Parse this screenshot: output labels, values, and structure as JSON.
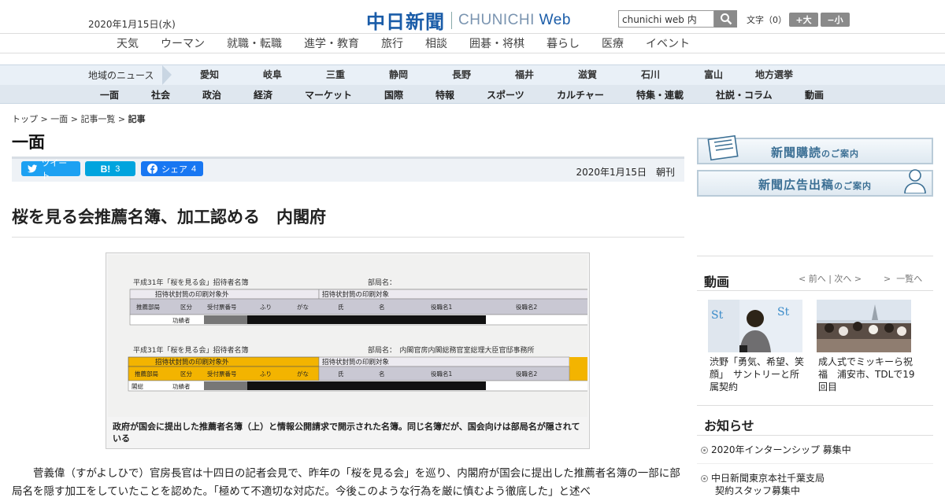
{
  "header": {
    "date": "2020年1月15日(水)",
    "logo_jp": "中日新聞",
    "logo_en_a": "CHUNICHI",
    "logo_en_b": " Web",
    "search_value": "chunichi web 内",
    "font_label": "文字（0）",
    "font_plus": "+大",
    "font_minus": "−小"
  },
  "topnav": [
    "天気",
    "ウーマン",
    "就職・転職",
    "進学・教育",
    "旅行",
    "相談",
    "囲碁・将棋",
    "暮らし",
    "医療",
    "イベント"
  ],
  "regional": {
    "label": "地域のニュース",
    "items": [
      "愛知",
      "岐阜",
      "三重",
      "静岡",
      "長野",
      "福井",
      "滋賀",
      "石川",
      "富山",
      "地方選挙"
    ]
  },
  "sections": [
    "一面",
    "社会",
    "政治",
    "経済",
    "マーケット",
    "国際",
    "特報",
    "スポーツ",
    "カルチャー",
    "特集・連載",
    "社説・コラム",
    "動画"
  ],
  "breadcrumb": {
    "a": "トップ",
    "b": "一面",
    "c": "記事一覧",
    "d": "記事"
  },
  "section_title": "一面",
  "share": {
    "tweet": "ツイート",
    "hatena_label": "B!",
    "hatena_count": "3",
    "fb_label": "シェア",
    "fb_count": "4"
  },
  "article": {
    "date": "2020年1月15日",
    "edition": "朝刊",
    "headline": "桜を見る会推薦名簿、加工認める　内閣府",
    "caption": "政府が国会に提出した推薦者名簿（上）と情報公開請求で開示された名簿。同じ名簿だが、国会向けは部局名が隠されている",
    "doc_top": {
      "title": "平成31年「桜を見る会」招待者名簿",
      "dept_label": "部局名：",
      "not_print": "招待状封筒の印刷対象外",
      "print": "招待状封筒の印刷対象",
      "cols": [
        "推薦部局",
        "区分",
        "受付票番号",
        "ふり",
        "がな",
        "氏",
        "名",
        "役職名1",
        "役職名2"
      ],
      "row_kubun": "功績者"
    },
    "doc_bottom": {
      "title": "平成31年「桜を見る会」招待者名簿",
      "dept_label": "部局名：　内閣官房内閣総務官室総理大臣官邸事務所",
      "not_print": "招待状封筒の印刷対象外",
      "print": "招待状封筒の印刷対象",
      "cols": [
        "推薦部局",
        "区分",
        "受付票番号",
        "ふり",
        "がな",
        "氏",
        "名",
        "役職名1",
        "役職名2"
      ],
      "row_dept": "閣総",
      "row_kubun": "功績者"
    },
    "body": "菅義偉（すがよしひで）官房長官は十四日の記者会見で、昨年の「桜を見る会」を巡り、内閣府が国会に提出した推薦者名簿の一部に部局名を隠す加工をしていたことを認めた。「極めて不適切な対応だ。今後このような行為を厳に慎むよう徹底した」と述べ"
  },
  "sidebar": {
    "banner1": "新聞購読",
    "banner1_small": "のご案内",
    "banner2": "新聞広告出稿",
    "banner2_small": "のご案内",
    "video_title": "動画",
    "video_nav": "< 前へ | 次へ >",
    "video_list": "一覧へ",
    "videos": [
      {
        "caption": "渋野「勇気、希望、笑顔」　サントリーと所属契約"
      },
      {
        "caption": "成人式でミッキーら祝福　浦安市、TDLで19回目"
      }
    ],
    "notice_title": "お知らせ",
    "notices": [
      "2020年インターンシップ 募集中",
      "中日新聞東京本社千葉支局",
      "契約スタッフ募集中"
    ]
  },
  "colors": {
    "brand": "#1a5ca8",
    "twitter": "#1da1f2",
    "hatena": "#00a4de",
    "facebook": "#1877f2",
    "highlight": "#f3b400"
  }
}
